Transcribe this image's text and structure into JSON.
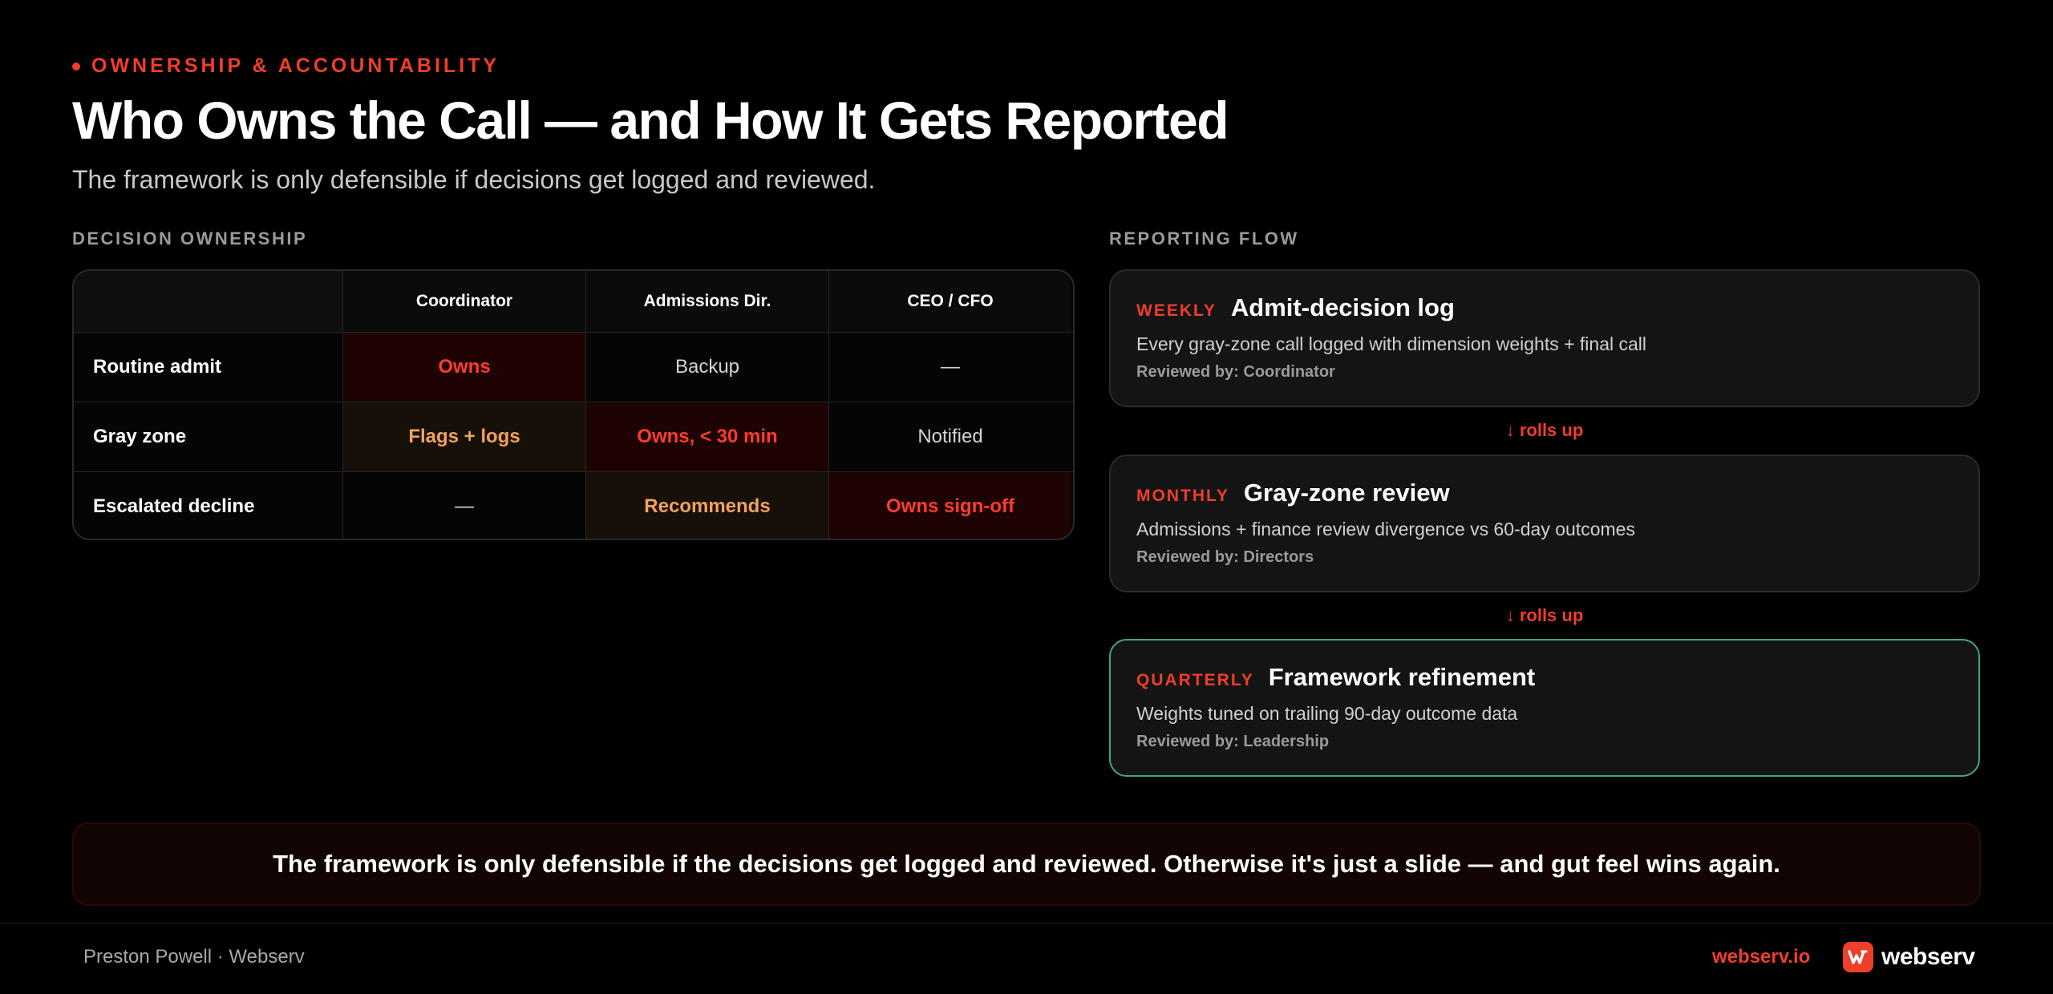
{
  "header": {
    "eyebrow": "OWNERSHIP & ACCOUNTABILITY",
    "title": "Who Owns the Call — and How It Gets Reported",
    "subtitle": "The framework is only defensible if decisions get logged and reviewed."
  },
  "ownership": {
    "label": "DECISION OWNERSHIP",
    "columns": [
      "Coordinator",
      "Admissions Dir.",
      "CEO / CFO"
    ],
    "rows": [
      {
        "name": "Routine admit",
        "cells": [
          "Owns",
          "Backup",
          "—"
        ]
      },
      {
        "name": "Gray zone",
        "cells": [
          "Flags + logs",
          "Owns, < 30 min",
          "Notified"
        ]
      },
      {
        "name": "Escalated decline",
        "cells": [
          "—",
          "Recommends",
          "Owns sign-off"
        ]
      }
    ]
  },
  "flow": {
    "label": "REPORTING FLOW",
    "cards": [
      {
        "freq": "WEEKLY",
        "title": "Admit-decision log",
        "desc": "Every gray-zone call logged with dimension weights + final call",
        "reviewed": "Reviewed by: Coordinator"
      },
      {
        "freq": "MONTHLY",
        "title": "Gray-zone review",
        "desc": "Admissions + finance review divergence vs 60-day outcomes",
        "reviewed": "Reviewed by: Directors"
      },
      {
        "freq": "QUARTERLY",
        "title": "Framework refinement",
        "desc": "Weights tuned on trailing 90-day outcome data",
        "reviewed": "Reviewed by: Leadership"
      }
    ],
    "connector": "↓ rolls up"
  },
  "banner": "The framework is only defensible if the decisions get logged and reviewed. Otherwise it's just a slide — and gut feel wins again.",
  "footer": {
    "author": "Preston Powell · Webserv",
    "url": "webserv.io",
    "brand": "webserv"
  },
  "colors": {
    "accent": "#ef3e2a",
    "amber": "#f2a25c",
    "highlight_border": "#3fa58a"
  }
}
